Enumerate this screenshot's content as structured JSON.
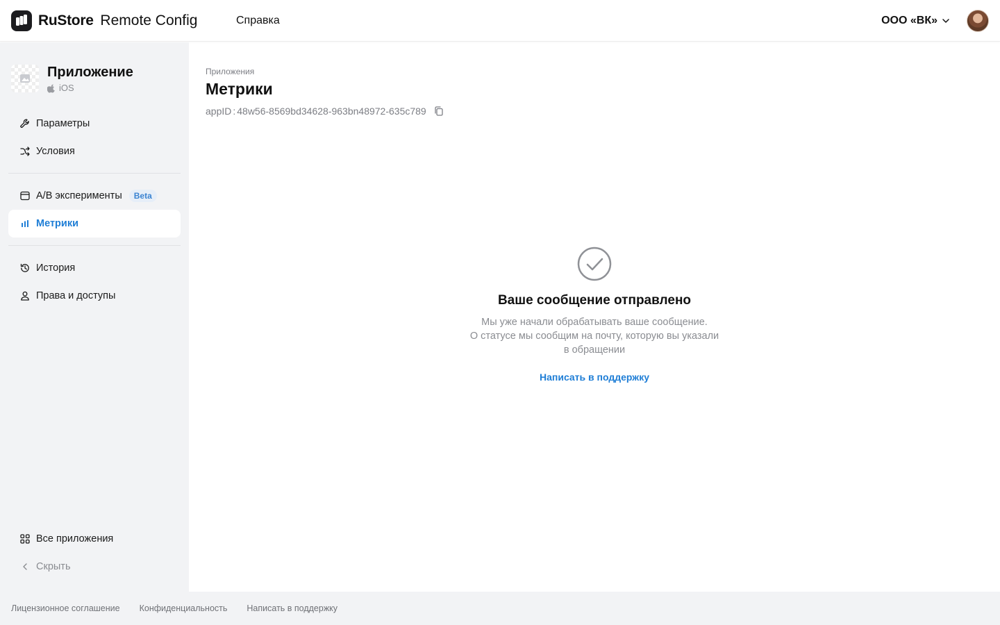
{
  "header": {
    "brand": "RuStore",
    "product": "Remote Config",
    "help_label": "Справка",
    "org_label": "ООО «ВК»"
  },
  "sidebar": {
    "app": {
      "name": "Приложение",
      "platform": "iOS"
    },
    "items": [
      {
        "label": "Параметры",
        "icon": "wrench-icon"
      },
      {
        "label": "Условия",
        "icon": "shuffle-icon"
      },
      {
        "label": "A/B эксперименты",
        "icon": "calendar-icon",
        "badge": "Beta"
      },
      {
        "label": "Метрики",
        "icon": "bar-chart-icon",
        "active": true
      },
      {
        "label": "История",
        "icon": "history-icon"
      },
      {
        "label": "Права и доступы",
        "icon": "user-icon"
      }
    ],
    "bottom": [
      {
        "label": "Все приложения",
        "icon": "grid-icon"
      },
      {
        "label": "Скрыть",
        "icon": "chevron-left-icon"
      }
    ]
  },
  "main": {
    "breadcrumb": "Приложения",
    "title": "Метрики",
    "appid_label": "appID",
    "appid_sep": ":",
    "appid_value": "48w56-8569bd34628-963bn48972-635c789"
  },
  "success": {
    "title": "Ваше сообщение отправлено",
    "lines": [
      "Мы уже начали обрабатывать ваше сообщение.",
      "О статусе мы сообщим на почту, которую вы указали",
      "в обращении"
    ],
    "link": "Написать в поддержку"
  },
  "footer": {
    "links": [
      "Лицензионное соглашение",
      "Конфиденциальность",
      "Написать в поддержку"
    ]
  },
  "colors": {
    "accent": "#1f7ed6",
    "sidebar_bg": "#f2f3f5",
    "muted_text": "#8a8c91",
    "beta_bg": "#e6eef8"
  }
}
